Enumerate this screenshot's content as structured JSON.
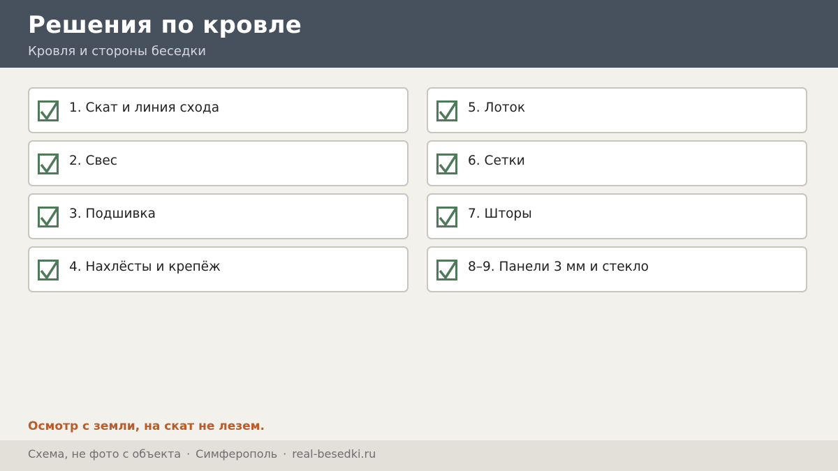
{
  "header": {
    "title": "Решения по кровле",
    "subtitle": "Кровля и стороны беседки"
  },
  "checklist": {
    "left": [
      {
        "label": "1. Скат и линия схода",
        "checked": true
      },
      {
        "label": "2. Свес",
        "checked": true
      },
      {
        "label": "3. Подшивка",
        "checked": true
      },
      {
        "label": "4. Нахлёсты и крепёж",
        "checked": true
      }
    ],
    "right": [
      {
        "label": "5. Лоток",
        "checked": true
      },
      {
        "label": "6. Сетки",
        "checked": true
      },
      {
        "label": "7. Шторы",
        "checked": true
      },
      {
        "label": "8–9. Панели 3 мм и стекло",
        "checked": true
      }
    ]
  },
  "note": "Осмотр с земли, на скат не лезем.",
  "footer": {
    "parts": [
      "Схема, не фото с объекта",
      "Симферополь",
      "real-besedki.ru"
    ],
    "separator": "·"
  },
  "colors": {
    "header_bg": "#47515d",
    "check_green": "#4f7a59",
    "note_orange": "#b85c2a",
    "page_bg": "#f3f1ec",
    "footer_bg": "#e3e0da"
  }
}
